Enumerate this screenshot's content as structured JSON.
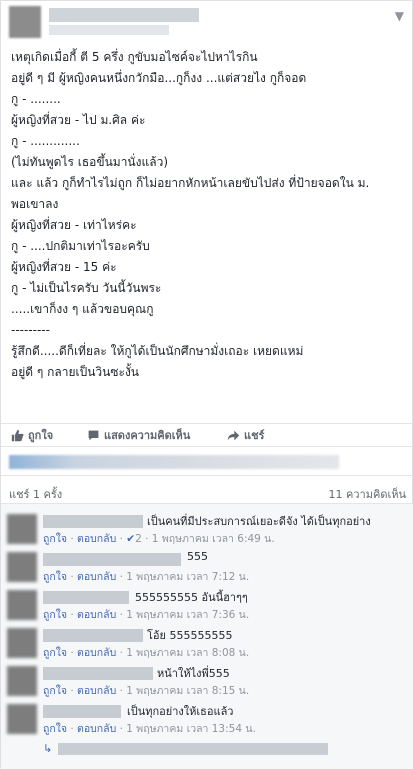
{
  "post": {
    "lines": [
      "เหตุเกิดเมื่อกี้ ตี 5 ครึ่ง กูขับมอไซค์จะไปหาไรกิน",
      "อยู่ดี ๆ มี ผู้หญิงคนหนึ่งกวักมือ...กูก็งง ...แต่สวยไง กูก็จอด",
      "กู - ........",
      "ผู้หญิงที่สวย - ไป ม.ศิล ค่ะ",
      "กู - .............",
      "(ไม่ทันพูดไร เธอขึ้นมานั่งแล้ว)",
      "และ แล้ว กูก็ทำไรไม่ถูก ก็ไม่อยากหักหน้าเลยขับไปส่ง ที่ป้ายจอดใน ม.",
      "พอเขาลง",
      "ผู้หญิงที่สวย - เท่าไหร่คะ",
      "กู - ....ปกติมาเท่าไรอะครับ",
      "ผู้หญิงที่สวย - 15 ค่ะ",
      "กู - ไม่เป็นไรครับ วันนี้วันพระ",
      ".....เขาก็งง ๆ แล้วขอบคุณกู",
      "---------",
      "รู้สึกดี.....ดีก็เที่ยละ ให้กูได้เป็นนักศึกษามั่งเถอะ เหยดแหม่",
      "อยู่ดี ๆ กลายเป็นวินซะงั้น"
    ]
  },
  "actions": {
    "like": "ถูกใจ",
    "comment": "แสดงความคิดเห็น",
    "share": "แชร์"
  },
  "meta": {
    "shares": "แชร์ 1 ครั้ง",
    "comments": "11 ความคิดเห็น"
  },
  "comments": [
    {
      "text": "เป็นคนที่มีประสบการณ์เยอะดีจัง ได้เป็นทุกอย่าง",
      "like": "ถูกใจ",
      "reply": "ตอบกลับ",
      "reactions": "2",
      "time": "1 พฤษภาคม เวลา 6:49 น."
    },
    {
      "text": "555",
      "like": "ถูกใจ",
      "reply": "ตอบกลับ",
      "time": "1 พฤษภาคม เวลา 7:12 น."
    },
    {
      "text": "555555555 อันนี้ฮาๆๆ",
      "like": "ถูกใจ",
      "reply": "ตอบกลับ",
      "time": "1 พฤษภาคม เวลา 7:36 น."
    },
    {
      "text": "โอ้ย 555555555",
      "like": "ถูกใจ",
      "reply": "ตอบกลับ",
      "time": "1 พฤษภาคม เวลา 8:08 น."
    },
    {
      "text": "หน้าให้ไงพี่555",
      "like": "ถูกใจ",
      "reply": "ตอบกลับ",
      "time": "1 พฤษภาคม เวลา 8:15 น."
    },
    {
      "text": "เป็นทุกอย่างให้เธอแล้ว",
      "like": "ถูกใจ",
      "reply": "ตอบกลับ",
      "time": "1 พฤษภาคม เวลา 13:54 น."
    }
  ]
}
